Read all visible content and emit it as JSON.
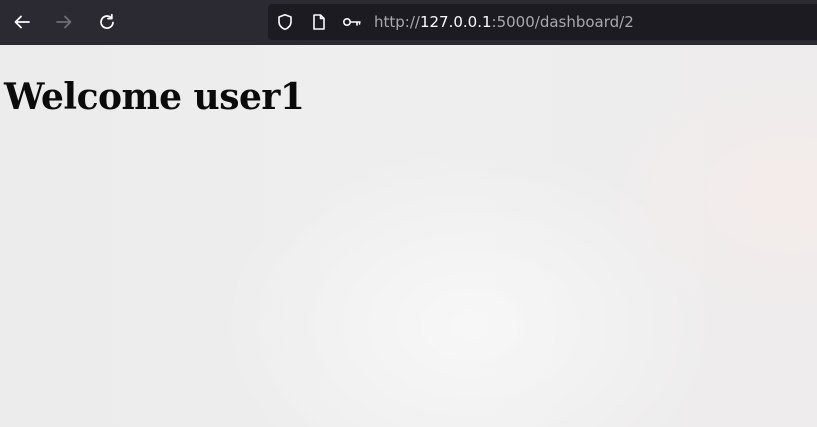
{
  "browser": {
    "nav": {
      "back_icon": "arrow-left-icon",
      "forward_icon": "arrow-right-icon",
      "reload_icon": "reload-icon"
    },
    "urlbar": {
      "icons": [
        "shield-icon",
        "page-icon",
        "key-icon"
      ],
      "url_prefix": "http://",
      "url_host": "127.0.0.1",
      "url_rest": ":5000/dashboard/2"
    },
    "colors": {
      "toolbar_bg": "#2b2a33",
      "urlbar_bg": "#1c1b22",
      "page_bg": "#efefef"
    }
  },
  "page": {
    "heading": "Welcome user1"
  }
}
